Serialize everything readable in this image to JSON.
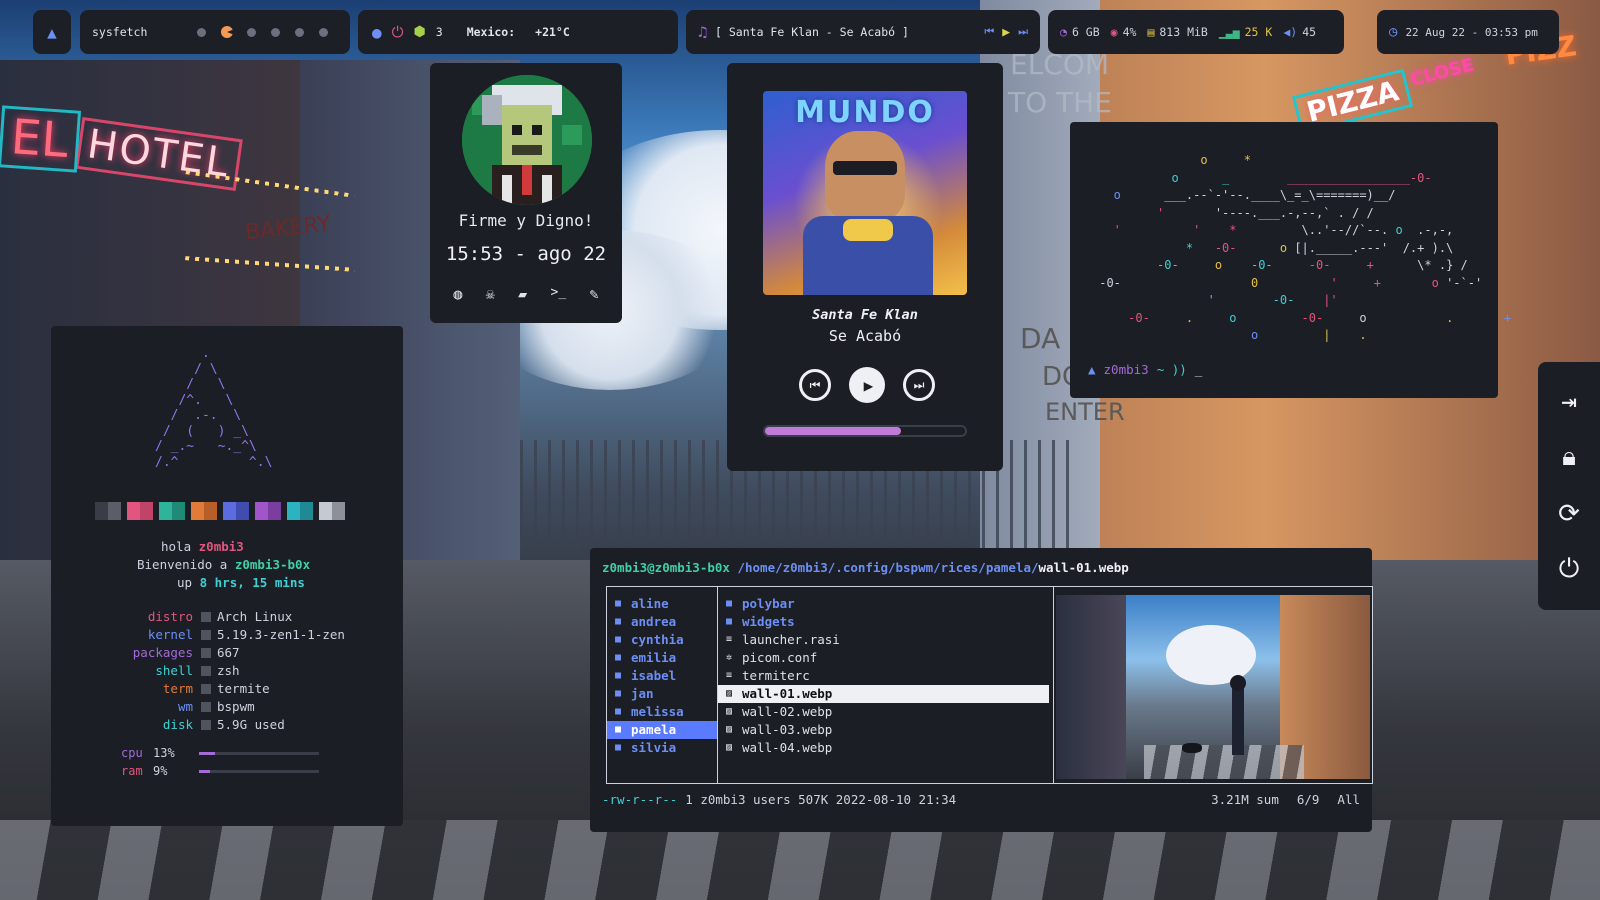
{
  "topbar": {
    "launcher_icon": "arch-icon",
    "sysfetch_label": "sysfetch",
    "workspaces": 6,
    "workspace_count": "3",
    "weather_location": "Mexico:",
    "weather_temp": "+21°C",
    "now_playing": "[ Santa Fe Klan - Se Acabó ]",
    "memory_total": "6 GB",
    "cpu_percent": "4%",
    "memory_used": "813 MiB",
    "network": "25 K",
    "volume": "45",
    "datetime": "22 Aug 22 - 03:53 pm"
  },
  "profile": {
    "motto": "Firme y Digno!",
    "time": "15:53 - ago 22",
    "actions": [
      "globe-icon",
      "skull-icon",
      "folder-icon",
      "terminal-icon",
      "edit-icon"
    ],
    "terminal_glyph": ">_"
  },
  "music": {
    "artist": "Santa Fe Klan",
    "title": "Se Acabó",
    "progress": 0.68,
    "cover_text": "MUNDO"
  },
  "fetch": {
    "greeting": "hola",
    "user": "z0mbi3",
    "welcome": "Bienvenido a",
    "host": "z0mbi3-b0x",
    "up_label": "up",
    "uptime": "8 hrs, 15 mins",
    "rows": [
      {
        "key": "distro",
        "value": "Arch Linux"
      },
      {
        "key": "kernel",
        "value": "5.19.3-zen1-1-zen"
      },
      {
        "key": "packages",
        "value": "667"
      },
      {
        "key": "shell",
        "value": "zsh"
      },
      {
        "key": "term",
        "value": "termite"
      },
      {
        "key": "wm",
        "value": "bspwm"
      },
      {
        "key": "disk",
        "value": "5.9G used"
      }
    ],
    "cpu_label": "cpu",
    "cpu_value": "13%",
    "cpu_fraction": 0.13,
    "ram_label": "ram",
    "ram_value": "9%",
    "ram_fraction": 0.09,
    "swatches": [
      "#3a3d45",
      "#5a5e68",
      "#e0567e",
      "#c04468",
      "#2fb39a",
      "#1f8a76",
      "#e07b39",
      "#b85f28",
      "#5b6be0",
      "#3f4cb0",
      "#a055c8",
      "#7b3ea0",
      "#2bb3c0",
      "#1f8a94",
      "#c5c9d0",
      "#8c9099"
    ]
  },
  "terminal": {
    "prompt_user": "z0mbi3",
    "prompt_rest": "~ ))",
    "cursor": "_",
    "prompt_icon": "arch-icon"
  },
  "ranger": {
    "user_host": "z0mbi3@z0mbi3-b0x",
    "path": "/home/z0mbi3/.config/bspwm/rices/pamela/",
    "file": "wall-01.webp",
    "left": [
      "aline",
      "andrea",
      "cynthia",
      "emilia",
      "isabel",
      "jan",
      "melissa",
      "pamela",
      "silvia"
    ],
    "left_selected": 7,
    "middle": [
      {
        "name": "polybar",
        "type": "dir"
      },
      {
        "name": "widgets",
        "type": "dir"
      },
      {
        "name": "launcher.rasi",
        "type": "file"
      },
      {
        "name": "picom.conf",
        "type": "conf"
      },
      {
        "name": "termiterc",
        "type": "file"
      },
      {
        "name": "wall-01.webp",
        "type": "image"
      },
      {
        "name": "wall-02.webp",
        "type": "image"
      },
      {
        "name": "wall-03.webp",
        "type": "image"
      },
      {
        "name": "wall-04.webp",
        "type": "image"
      }
    ],
    "middle_selected": 5,
    "status_perms": "-rw-r--r--",
    "status_info": "1 z0mbi3 users 507K 2022-08-10 21:34",
    "status_sum": "3.21M sum",
    "status_pos": "6/9",
    "status_all": "All"
  },
  "sidebar": [
    "logout-icon",
    "lock-icon",
    "refresh-icon",
    "power-icon"
  ],
  "scenery": {
    "hotel_sign": "HOTEL",
    "hotel_left": "EL",
    "bakery_sign": "BAKERY",
    "pizza_sign": "PIZZA",
    "close_sign": "CLOSE",
    "pizz_sign": "PIZZ",
    "enter_sign": "ENTER",
    "da_sign": "DA",
    "do_sign": "DO",
    "welcome_sign": "ELCOM",
    "tothe_sign": "TO THE"
  },
  "colors": {
    "accent_blue": "#6d8ff5",
    "accent_pink": "#e0567e",
    "accent_cyan": "#3fd0d4",
    "accent_purple": "#a36ad8",
    "accent_green": "#8ad05a"
  }
}
